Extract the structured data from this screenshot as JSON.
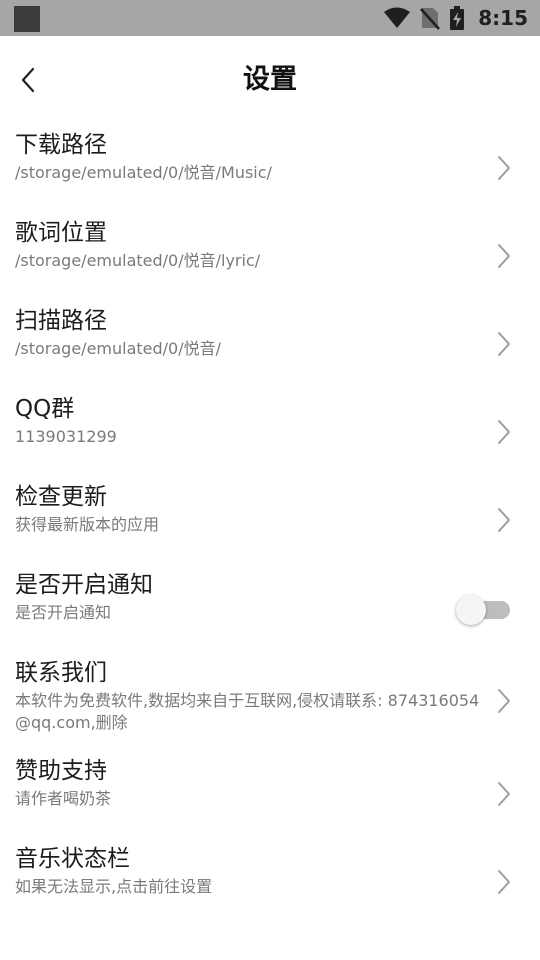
{
  "status_bar": {
    "time": "8:15",
    "icons": [
      "wifi-icon",
      "no-sim-icon",
      "battery-charging-icon"
    ]
  },
  "header": {
    "title": "设置",
    "back_icon": "chevron-left-icon"
  },
  "settings": [
    {
      "title": "下载路径",
      "subtitle": "/storage/emulated/0/悦音/Music/"
    },
    {
      "title": "歌词位置",
      "subtitle": "/storage/emulated/0/悦音/lyric/"
    },
    {
      "title": "扫描路径",
      "subtitle": "/storage/emulated/0/悦音/"
    },
    {
      "title": "QQ群",
      "subtitle": "1139031299"
    },
    {
      "title": "检查更新",
      "subtitle": "获得最新版本的应用"
    },
    {
      "title": "是否开启通知",
      "subtitle": "是否开启通知",
      "toggle_on": false
    },
    {
      "title": "联系我们",
      "subtitle": "本软件为免费软件,数据均来自于互联网,侵权请联系: 874316054@qq.com,删除"
    },
    {
      "title": "赞助支持",
      "subtitle": "请作者喝奶茶"
    },
    {
      "title": "音乐状态栏",
      "subtitle": "如果无法显示,点击前往设置"
    }
  ],
  "colors": {
    "status_bar_bg": "#a6a6a6",
    "text_primary": "#1c1c1c",
    "text_secondary": "#7a7a7a",
    "toggle_track_off": "#bdbdbd"
  }
}
